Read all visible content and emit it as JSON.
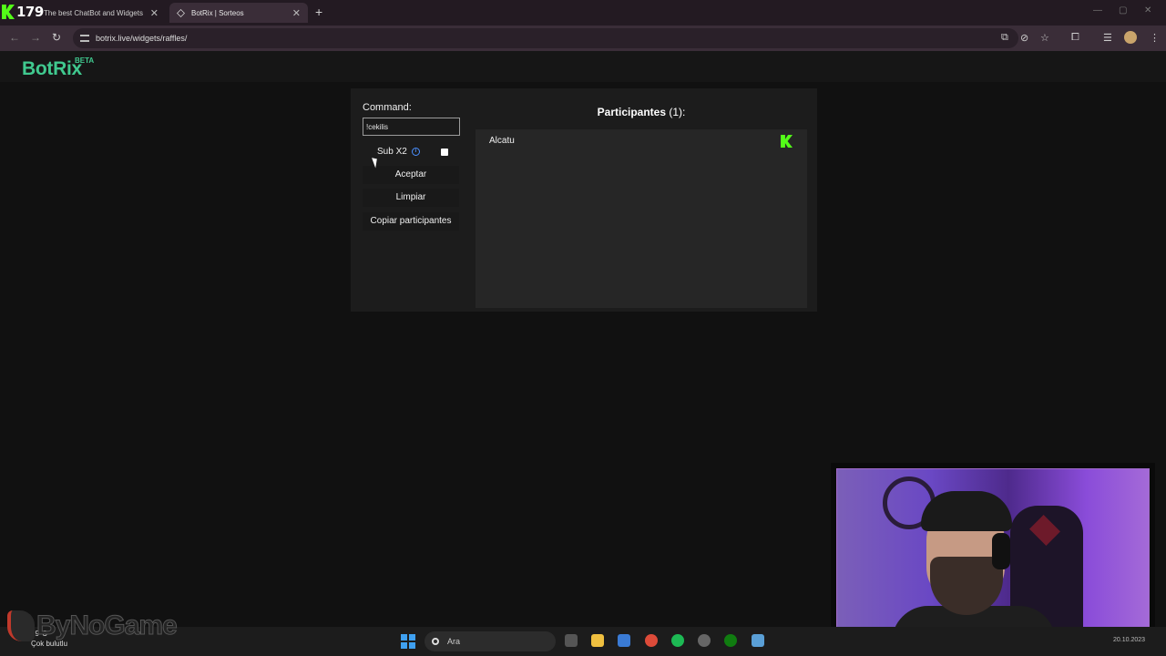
{
  "browser": {
    "kick_counter": "179",
    "tabs": [
      {
        "title": "The best ChatBot and Widgets",
        "close": "✕"
      },
      {
        "title": "BotRix | Sorteos",
        "close": "✕"
      }
    ],
    "new_tab": "+",
    "window_controls": [
      "—",
      "▢",
      "✕"
    ],
    "nav": {
      "back": "←",
      "forward": "→",
      "reload": "↻"
    },
    "url": "botrix.live/widgets/raffles/",
    "toolbar_icons": [
      "translate-icon",
      "eye-off-icon",
      "star-icon",
      "extensions-icon",
      "media-icon",
      "profile-avatar",
      "menu-icon"
    ]
  },
  "site": {
    "logo": "BotRix",
    "badge": "BETA",
    "accent": "#40c98f"
  },
  "raffle": {
    "command_label": "Command:",
    "command_value": "!cekilis",
    "sub_label": "Sub X2",
    "sub_checked": false,
    "buttons": {
      "accept": "Aceptar",
      "clear": "Limpiar",
      "copy": "Copiar participantes"
    },
    "participants_title": "Participantes",
    "participants_count": "(1):",
    "participants": [
      {
        "name": "Alcatu",
        "platform_icon": "kick-icon",
        "platform_color": "#53fc18"
      }
    ]
  },
  "watermark": {
    "text": "ByNoGame"
  },
  "taskbar": {
    "weather_temp": "19°C",
    "weather_text": "Çok bulutlu",
    "search_placeholder": "Ara",
    "clock": "20.10.2023"
  }
}
